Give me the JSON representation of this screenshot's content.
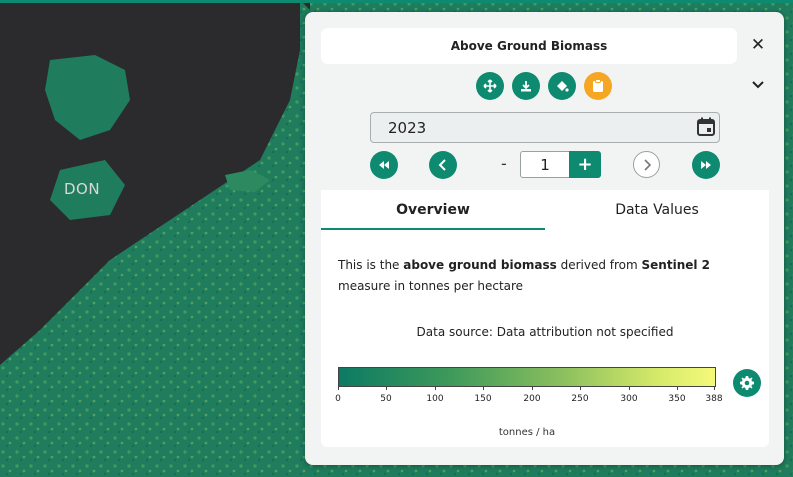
{
  "map": {
    "place_label": "DON"
  },
  "panel": {
    "title": "Above Ground Biomass",
    "close_icon": "close-icon",
    "collapse_icon": "chevron-down-icon",
    "toolbar": [
      {
        "icon": "move-icon"
      },
      {
        "icon": "download-icon"
      },
      {
        "icon": "paint-bucket-icon"
      },
      {
        "icon": "clipboard-icon",
        "active": true
      }
    ],
    "date": {
      "value": "2023",
      "icon": "calendar-icon"
    },
    "nav": {
      "minus": "-",
      "step_value": "1",
      "plus": "+"
    },
    "tabs": [
      {
        "label": "Overview",
        "active": true
      },
      {
        "label": "Data Values"
      }
    ],
    "description": {
      "part1": "This is the ",
      "bold1": "above ground biomass",
      "part2": " derived from ",
      "bold2": "Sentinel 2",
      "part3": " measure in tonnes per hectare"
    },
    "source": "Data source: Data attribution not specified",
    "legend": {
      "ticks": [
        "0",
        "50",
        "100",
        "150",
        "200",
        "250",
        "300",
        "350",
        "388"
      ],
      "tick_values": [
        0,
        50,
        100,
        150,
        200,
        250,
        300,
        350,
        388
      ],
      "max": 388,
      "unit": "tonnes / ha",
      "colors": [
        "#0c7a63",
        "#3f9a5a",
        "#8dc05e",
        "#d6ea6a",
        "#f5f97a"
      ]
    },
    "settings_icon": "gear-icon"
  }
}
